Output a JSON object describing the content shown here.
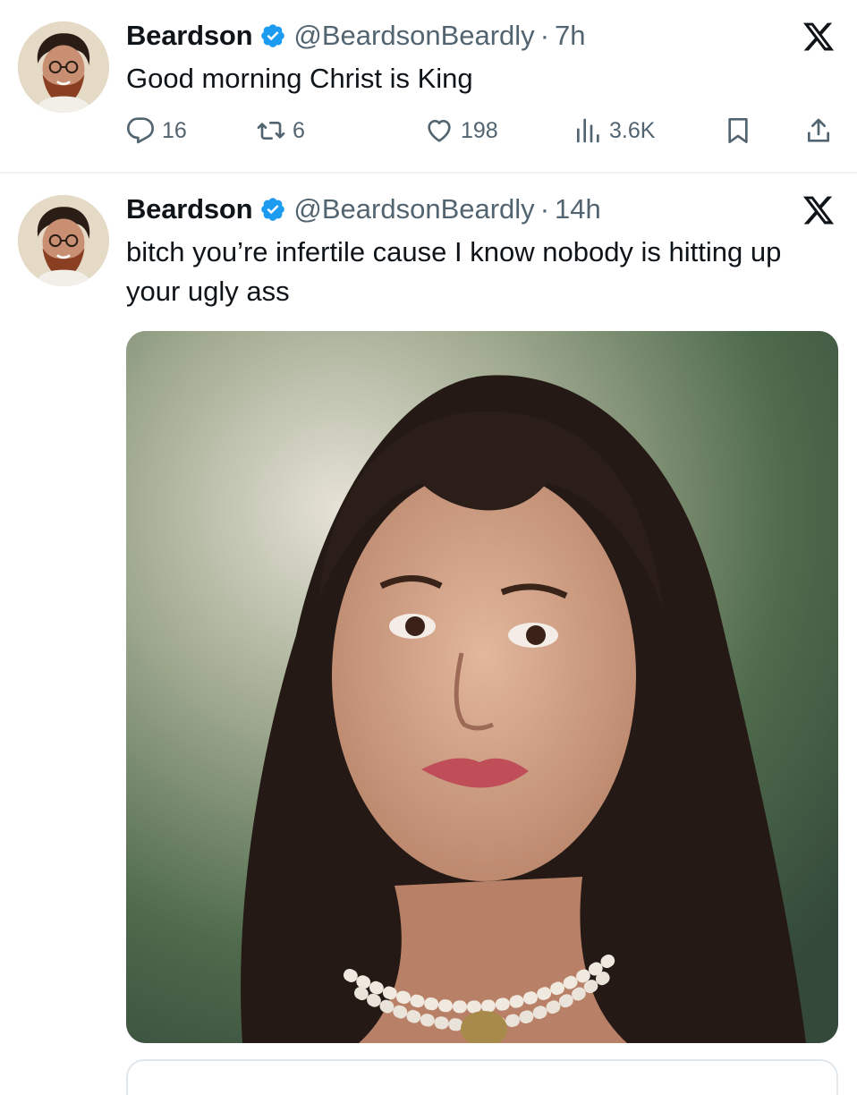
{
  "tweets": [
    {
      "name": "Beardson",
      "handle": "@BeardsonBeardly",
      "separator": "·",
      "time": "7h",
      "text": "Good morning Christ is King",
      "stats": {
        "replies": "16",
        "retweets": "6",
        "likes": "198",
        "views": "3.6K"
      }
    },
    {
      "name": "Beardson",
      "handle": "@BeardsonBeardly",
      "separator": "·",
      "time": "14h",
      "text": "bitch you’re infertile cause I know nobody is hitting up your ugly ass"
    }
  ],
  "icons": {
    "verified": "verified-badge-icon",
    "brand": "x-logo-icon",
    "reply": "reply-icon",
    "retweet": "retweet-icon",
    "like": "heart-icon",
    "views": "views-icon",
    "bookmark": "bookmark-icon",
    "share": "share-icon"
  },
  "colors": {
    "text": "#0f1419",
    "secondary": "#536471",
    "verified": "#1d9bf0",
    "divider": "#eff3f4"
  }
}
